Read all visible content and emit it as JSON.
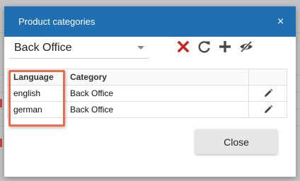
{
  "dialog": {
    "title": "Product categories",
    "close_glyph": "×"
  },
  "toolbar": {
    "selected_value": "Back Office",
    "icons": [
      "delete-icon",
      "refresh-icon",
      "add-icon",
      "hide-icon"
    ],
    "delete_color": "#cc1f1f",
    "icon_color": "#4a4a4a"
  },
  "table": {
    "columns": [
      "Language",
      "Category",
      ""
    ],
    "rows": [
      {
        "language": "english",
        "category": "Back Office"
      },
      {
        "language": "german",
        "category": "Back Office"
      }
    ]
  },
  "footer": {
    "close_label": "Close"
  },
  "colors": {
    "header": "#1f6fb2",
    "highlight": "#f06a4c"
  }
}
